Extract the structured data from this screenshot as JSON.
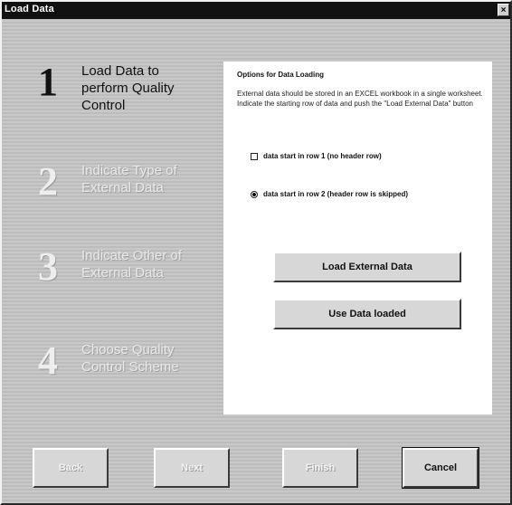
{
  "window": {
    "title": "Load Data",
    "close_glyph": "×"
  },
  "steps": [
    {
      "number": "1",
      "line1": "Load Data to",
      "line2": "perform Quality",
      "line3": "Control",
      "state": "active"
    },
    {
      "number": "2",
      "line1": "Indicate Type of",
      "line2": "External Data",
      "line3": "",
      "state": "disabled"
    },
    {
      "number": "3",
      "line1": "Indicate Other of",
      "line2": "External Data",
      "line3": "",
      "state": "disabled"
    },
    {
      "number": "4",
      "line1": "Choose Quality",
      "line2": "Control Scheme",
      "line3": "",
      "state": "disabled"
    }
  ],
  "panel": {
    "heading": "Options for Data Loading",
    "description": "External data should be stored in an EXCEL workbook in a single worksheet. Indicate the starting row of data and push the \"Load External Data\" button",
    "option1": {
      "label": "data start in row 1 (no header row)",
      "selected": false
    },
    "option2": {
      "label": "data start in row 2 (header row is skipped)",
      "selected": true
    },
    "load_external_label": "Load External Data",
    "use_loaded_label": "Use Data loaded"
  },
  "nav": {
    "back_label": "Back",
    "next_label": "Next",
    "finish_label": "Finish",
    "cancel_label": "Cancel"
  }
}
